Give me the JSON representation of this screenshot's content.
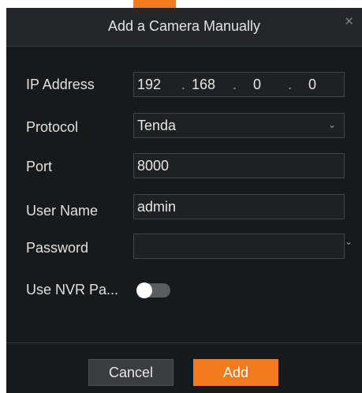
{
  "dialog": {
    "title": "Add a Camera Manually",
    "close_icon": "close-icon"
  },
  "form": {
    "ip": {
      "label": "IP Address",
      "octets": [
        "192",
        "168",
        "0",
        "0"
      ],
      "separator": "."
    },
    "protocol": {
      "label": "Protocol",
      "value": "Tenda",
      "icon": "chevron-down-icon"
    },
    "port": {
      "label": "Port",
      "value": "8000"
    },
    "username": {
      "label": "User Name",
      "value": "admin"
    },
    "password": {
      "label": "Password",
      "value": "",
      "icon": "eye-closed-icon"
    },
    "use_nvr_password": {
      "label": "Use NVR Pa...",
      "enabled": false
    }
  },
  "buttons": {
    "cancel": "Cancel",
    "add": "Add"
  },
  "colors": {
    "accent": "#f37a1f",
    "dialog_background": "#17191b",
    "header_background": "#242629",
    "input_background": "#1e2022",
    "text": "#e6e6e6",
    "toggle_off": "#5a5c60"
  }
}
